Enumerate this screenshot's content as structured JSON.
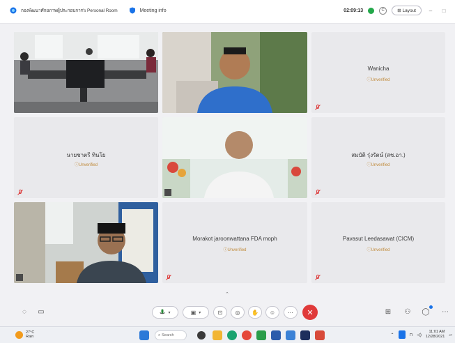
{
  "titlebar": {
    "room_title": "กองพัฒนาศักยภาพผู้ประกอบการ's Personal Room",
    "meeting_info": "Meeting info",
    "timer": "02:09:13",
    "layout_label": "Layout"
  },
  "participants": [
    {
      "name": "",
      "status": "",
      "kind": "video"
    },
    {
      "name": "",
      "status": "",
      "kind": "video"
    },
    {
      "name": "Wanicha",
      "status": "Unverified",
      "kind": "avatar"
    },
    {
      "name": "นายชาตรี ทินโย",
      "status": "Unverified",
      "kind": "avatar"
    },
    {
      "name": "",
      "status": "",
      "kind": "video"
    },
    {
      "name": "สมบัติ รุ่งรัตน์ (สช.อา.)",
      "status": "Unverified",
      "kind": "avatar"
    },
    {
      "name": "",
      "status": "",
      "kind": "video"
    },
    {
      "name": "Morakot jaroonwattana FDA moph",
      "status": "Unverified",
      "kind": "avatar"
    },
    {
      "name": "Pavasut Leedasawat (CICM)",
      "status": "Unverified",
      "kind": "avatar"
    }
  ],
  "taskbar": {
    "temperature": "27°C",
    "weather_desc": "Rain",
    "search_label": "Search",
    "time": "11:01 AM",
    "date": "12/28/2021"
  },
  "colors": {
    "end_call": "#e03a3a",
    "unverified": "#c08a3a",
    "secure": "#23a84a",
    "accent": "#1a73e8"
  }
}
